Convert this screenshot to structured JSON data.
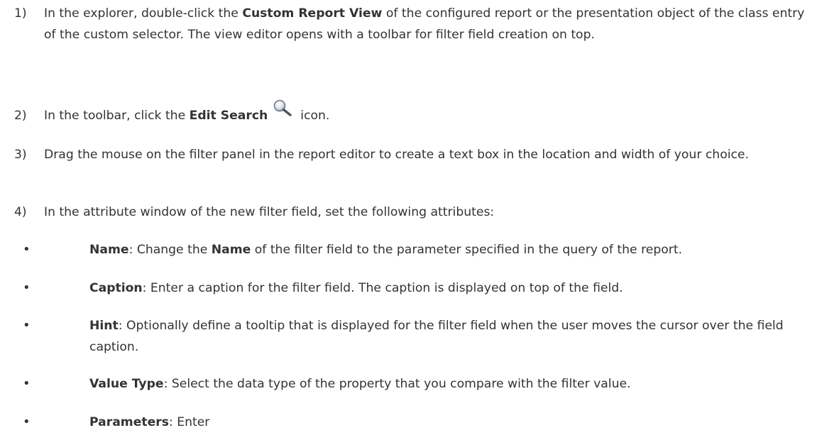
{
  "steps": [
    {
      "num": "1)",
      "pre": "In the explorer, double-click the ",
      "bold": "Custom Report View",
      "post": " of the configured report or the presentation object of the class entry of the custom selector. The view editor opens with a toolbar for filter field creation on top."
    },
    {
      "num": "2)",
      "pre": "In the toolbar, click the ",
      "bold": "Edit Search",
      "post": "icon.",
      "icon": "magnifier-icon"
    },
    {
      "num": "3)",
      "text": "Drag the mouse on the filter panel in the report editor to create a text box in the location and width of your choice."
    },
    {
      "num": "4)",
      "text": "In the attribute window of the new filter field, set the following attributes:"
    }
  ],
  "bullets": [
    {
      "term": "Name",
      "mid": ": Change the ",
      "bold2": "Name",
      "post": " of the filter field to the parameter specified in the query of the report."
    },
    {
      "term": "Caption",
      "post": ": Enter a caption for the filter field. The caption is displayed on top of the field."
    },
    {
      "term": "Hint",
      "post": ": Optionally define a tooltip that is displayed for the filter field when the user moves the cursor over the field caption."
    },
    {
      "term": "Value Type",
      "post": ": Select the data type of the property that you compare with the filter value."
    },
    {
      "term": "Parameters",
      "post": ": Enter"
    }
  ],
  "bullet_symbol": "•"
}
